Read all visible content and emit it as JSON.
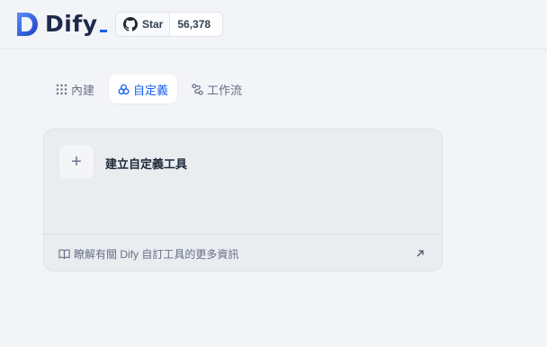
{
  "brand": {
    "name": "Dify",
    "accent": "#155eef"
  },
  "github": {
    "star_label": "Star",
    "star_count": "56,378"
  },
  "tabs": [
    {
      "label": "內建",
      "icon": "grid-dots-icon",
      "active": false
    },
    {
      "label": "自定義",
      "icon": "custom-tools-icon",
      "active": true
    },
    {
      "label": "工作流",
      "icon": "workflow-icon",
      "active": false
    }
  ],
  "create_card": {
    "plus_icon": "plus-icon",
    "title": "建立自定義工具",
    "footer_text": "瞭解有關 Dify 自訂工具的更多資訊",
    "footer_icon": "book-icon",
    "link_icon": "arrow-up-right-icon"
  }
}
